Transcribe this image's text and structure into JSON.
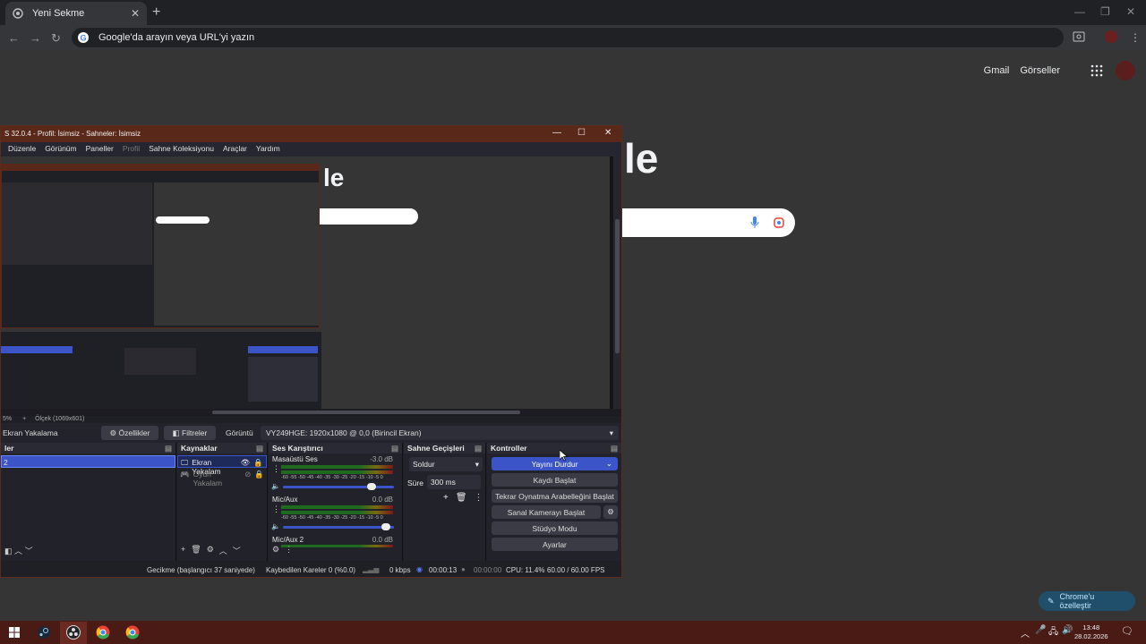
{
  "chrome": {
    "tab_title": "Yeni Sekme",
    "tab_close": "✕",
    "new_tab": "+",
    "omnibox_placeholder": "Google'da arayın veya URL'yi yazın",
    "links": [
      "Gmail",
      "Görseller"
    ],
    "logo_fragment": "le",
    "customize_label": "Chrome'u özelleştir"
  },
  "obs": {
    "title": "S 32.0.4 - Profil: İsimsiz - Sahneler: İsimsiz",
    "menu": [
      "Düzenle",
      "Görünüm",
      "Paneller",
      "Profil",
      "Sahne Koleksiyonu",
      "Araçlar",
      "Yardım"
    ],
    "menu_disabled_index": 3,
    "zoom_percent": "5%",
    "zoom_scale": "Ölçek (1069x601)",
    "source_name": "Ekran Yakalama",
    "properties_label": "Özellikler",
    "filters_label": "Filtreler",
    "display_label": "Görüntü",
    "display_value": "VY249HGE: 1920x1080 @ 0,0 (Birincil Ekran)",
    "scenes_header": "ler",
    "scene_item": "2",
    "sources_header": "Kaynaklar",
    "sources": [
      "Ekran Yakalam",
      "Oyun Yakalam"
    ],
    "mixer_header": "Ses Karıştırıcı",
    "mixer_channels": [
      {
        "name": "Masaüstü Ses",
        "db": "-3.0 dB"
      },
      {
        "name": "Mic/Aux",
        "db": "0.0 dB"
      },
      {
        "name": "Mic/Aux 2",
        "db": "0.0 dB"
      }
    ],
    "meter_scale": "-60 -55 -50 -45 -40 -35 -30 -25 -20 -15 -10 -5 0",
    "transitions_header": "Sahne Geçişleri",
    "transition": "Soldur",
    "duration_label": "Süre",
    "duration_value": "300 ms",
    "controls_header": "Kontroller",
    "controls": {
      "stop_stream": "Yayını Durdur",
      "start_record": "Kaydı Başlat",
      "replay_buffer": "Tekrar Oynatma Arabelleğini Başlat",
      "virtual_cam": "Sanal Kamerayı Başlat",
      "studio_mode": "Stüdyo Modu",
      "settings": "Ayarlar"
    },
    "status": {
      "delay": "Gecikme (başlangıcı 37 saniyede)",
      "dropped": "Kaybedilen Kareler 0 (%0.0)",
      "kbps": "0 kbps",
      "stream_time": "00:00:13",
      "rec_time": "00:00:00",
      "cpu": "CPU: 11.4%",
      "fps": "60.00 / 60.00 FPS"
    },
    "accent_color": "#3b55c9"
  },
  "taskbar": {
    "time": "13:48",
    "date": "28.02.2026"
  }
}
